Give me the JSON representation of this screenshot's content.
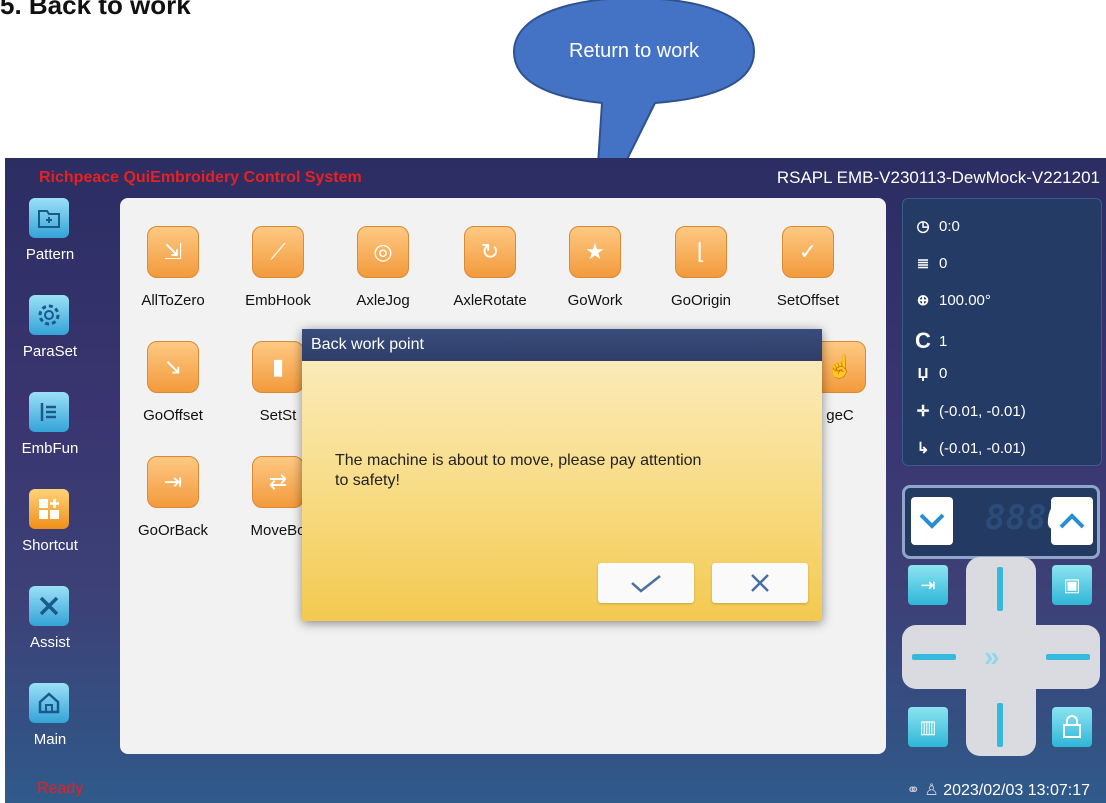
{
  "heading": "5. Back to work",
  "callout": "Return to work",
  "app": {
    "title": "Richpeace QuiEmbroidery Control System",
    "version": "RSAPL EMB-V230113-DewMock-V221201"
  },
  "nav": [
    {
      "label": "Pattern",
      "icon": "folder-icon"
    },
    {
      "label": "ParaSet",
      "icon": "gear-icon"
    },
    {
      "label": "EmbFun",
      "icon": "embroidery-icon"
    },
    {
      "label": "Shortcut",
      "icon": "shortcut-icon"
    },
    {
      "label": "Assist",
      "icon": "tools-icon"
    },
    {
      "label": "Main",
      "icon": "home-icon"
    }
  ],
  "tools_row1": [
    "AllToZero",
    "EmbHook",
    "AxleJog",
    "AxleRotate",
    "GoWork",
    "GoOrigin",
    "SetOffset"
  ],
  "tools_row2": {
    "left1": "GoOffset",
    "left2": "SetSt",
    "right": "geC"
  },
  "tools_row3": {
    "left1": "GoOrBack",
    "left2": "MoveBo"
  },
  "dialog": {
    "title": "Back work point",
    "message": "The machine is about to move, please pay attention to safety!"
  },
  "status": {
    "time": "0:0",
    "layers": "0",
    "angle": "100.00°",
    "color": "1",
    "needle": "0",
    "position1": "(-0.01, -0.01)",
    "position2": "(-0.01, -0.01)"
  },
  "counter": {
    "ghost": "888",
    "value": "0"
  },
  "statusbar": {
    "ready": "Ready",
    "datetime": "2023/02/03 13:07:17"
  },
  "colors": {
    "title_red": "#e8201f",
    "accent_orange": "#f39a3c",
    "accent_cyan": "#2fb6d8"
  }
}
